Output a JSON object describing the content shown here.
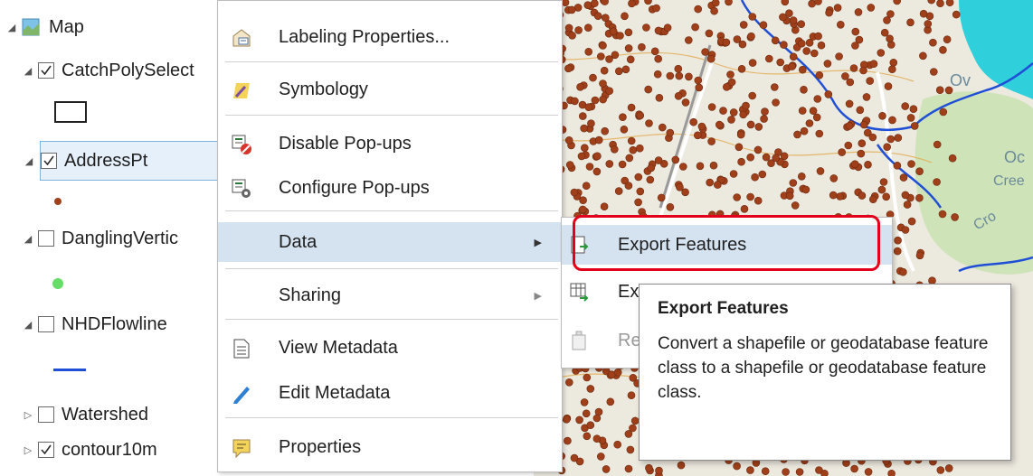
{
  "toc": {
    "map_label": "Map",
    "layers": [
      {
        "name": "CatchPolySelect",
        "checked": true,
        "expanded": true,
        "legend": "hollow-rect"
      },
      {
        "name": "AddressPt",
        "checked": true,
        "expanded": true,
        "legend": "brown-dot",
        "selected": true
      },
      {
        "name": "DanglingVertic",
        "checked": false,
        "expanded": true,
        "legend": "green-dot"
      },
      {
        "name": "NHDFlowline",
        "checked": false,
        "expanded": true,
        "legend": "blue-line"
      },
      {
        "name": "Watershed",
        "checked": false,
        "expanded": false
      },
      {
        "name": "contour10m",
        "checked": true,
        "expanded": false
      }
    ]
  },
  "context_menu": {
    "items": [
      {
        "label": "Labeling Properties...",
        "icon": "labeling-icon"
      },
      {
        "label": "Symbology",
        "icon": "symbology-icon"
      },
      {
        "label": "Disable Pop-ups",
        "icon": "disable-popups-icon"
      },
      {
        "label": "Configure Pop-ups",
        "icon": "configure-popups-icon"
      },
      {
        "label": "Data",
        "icon": "",
        "submenu": true
      },
      {
        "label": "Sharing",
        "icon": "",
        "submenu": true
      },
      {
        "label": "View Metadata",
        "icon": "view-metadata-icon"
      },
      {
        "label": "Edit Metadata",
        "icon": "edit-metadata-icon"
      },
      {
        "label": "Properties",
        "icon": "properties-icon"
      }
    ]
  },
  "submenu": {
    "items": [
      {
        "label": "Export Features",
        "icon": "export-features-icon"
      },
      {
        "label": "Ex",
        "icon": "export-table-icon"
      },
      {
        "label": "Re",
        "icon": "repair-icon",
        "disabled": true
      }
    ]
  },
  "tooltip": {
    "title": "Export Features",
    "body": "Convert a shapefile or geodatabase feature class to a shapefile or geodatabase feature class."
  },
  "map_labels": [
    "Ov",
    "Oc",
    "Cree",
    "Cro"
  ],
  "colors": {
    "hover": "#d5e3f1",
    "highlight": "#e3001b",
    "address_point": "#a0401a",
    "water": "#1f4fd6",
    "cyan_area": "#2fd0dc",
    "park": "#cfe3b8"
  }
}
